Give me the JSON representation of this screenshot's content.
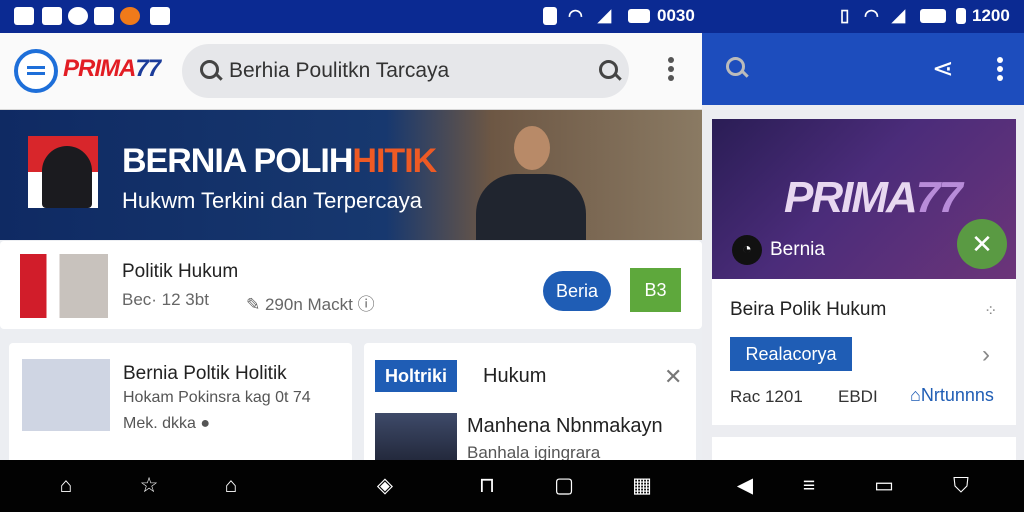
{
  "status": {
    "time_left": "0030",
    "time_right": "1200"
  },
  "app": {
    "logo_main": "PRIMA",
    "logo_accent": "77"
  },
  "search": {
    "value": "Berhia Poulitkn Tarcaya"
  },
  "banner": {
    "title_main": "BERNIA POLIH",
    "title_accent": "HITIK",
    "subtitle": "Hukwm Terkini dan Terpercaya"
  },
  "feature": {
    "title": "Politik Hukum",
    "meta_date": "Bec· 12 3bt",
    "meta_views": "290n Mackt",
    "button_primary": "Beria",
    "button_secondary": "B3"
  },
  "cards": [
    {
      "title": "Bernia Poltik Holitik",
      "subtitle": "Hokam Pokinsra kag 0t 74",
      "meta": "Mek. dkka"
    },
    {
      "badge": "Holtriki",
      "tag": "Hukum",
      "title": "Manhena Nbnmakayn",
      "subtitle": "Banhala igingrara"
    }
  ],
  "side": {
    "image_logo_main": "PRIMA",
    "image_logo_accent": "77",
    "image_caption": "Bernia",
    "card_title": "Beira Polik Hukum",
    "card_tag": "Realacorya",
    "meta_date": "Rac 1201",
    "meta_code": "EBDI",
    "meta_link": "Nrtunnns"
  },
  "colors": {
    "status_bar": "#0b2a92",
    "accent_blue": "#1f5db5",
    "accent_green": "#5ea83c",
    "logo_red": "#e21d24"
  },
  "icons": [
    "home-icon",
    "star-icon",
    "bag-icon",
    "logo-icon",
    "lock-icon",
    "square-icon",
    "grid-icon",
    "back-icon",
    "menu-icon",
    "recents-icon",
    "shield-icon"
  ]
}
